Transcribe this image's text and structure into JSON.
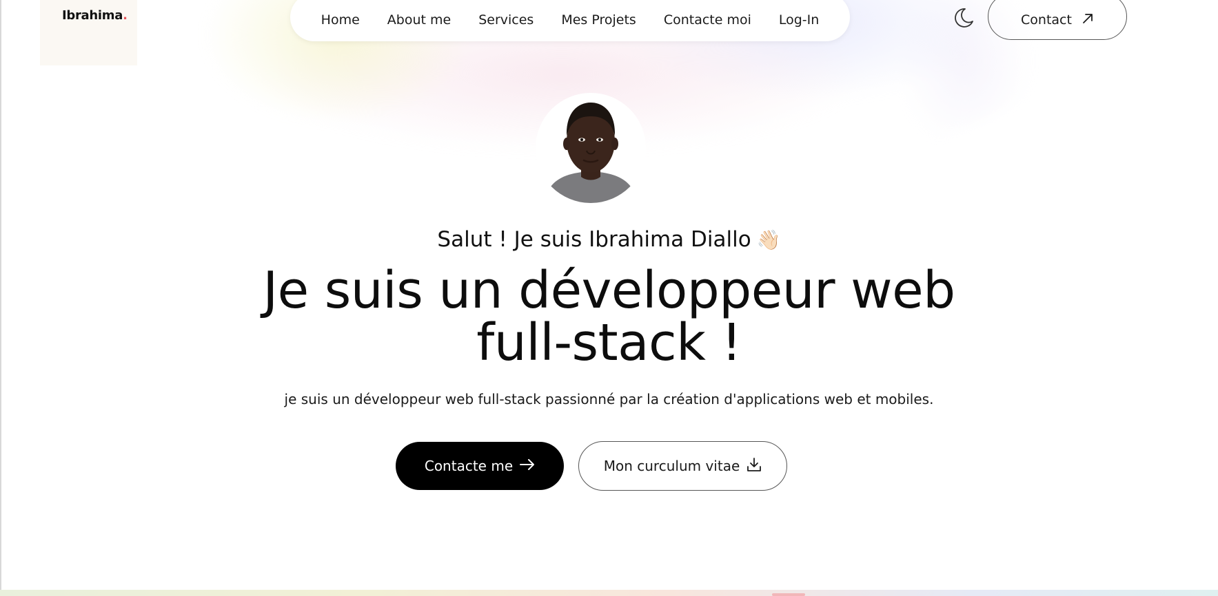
{
  "brand": {
    "name": "Ibrahima",
    "dot": ".",
    "dot_color": "#e8545a"
  },
  "nav": {
    "items": [
      {
        "label": "Home"
      },
      {
        "label": "About me"
      },
      {
        "label": "Services"
      },
      {
        "label": "Mes Projets"
      },
      {
        "label": "Contacte moi"
      },
      {
        "label": "Log-In"
      }
    ]
  },
  "header": {
    "theme_toggle_icon": "moon-icon",
    "contact_label": "Contact",
    "contact_icon": "arrow-up-right-icon"
  },
  "hero": {
    "avatar_alt": "avatar",
    "greeting": "Salut ! Je suis Ibrahima Diallo",
    "greeting_emoji": "👋🏻",
    "headline_line1": "Je suis un développeur web",
    "headline_line2": "full-stack !",
    "subtitle": "je suis un développeur web full-stack passionné par la création d'applications web et mobiles.",
    "primary_button": "Contacte me",
    "primary_icon": "arrow-right-icon",
    "secondary_button": "Mon curculum vitae",
    "secondary_icon": "download-icon"
  },
  "colors": {
    "primary_button_bg": "#000000",
    "text": "#111111",
    "accent": "#e8545a"
  }
}
